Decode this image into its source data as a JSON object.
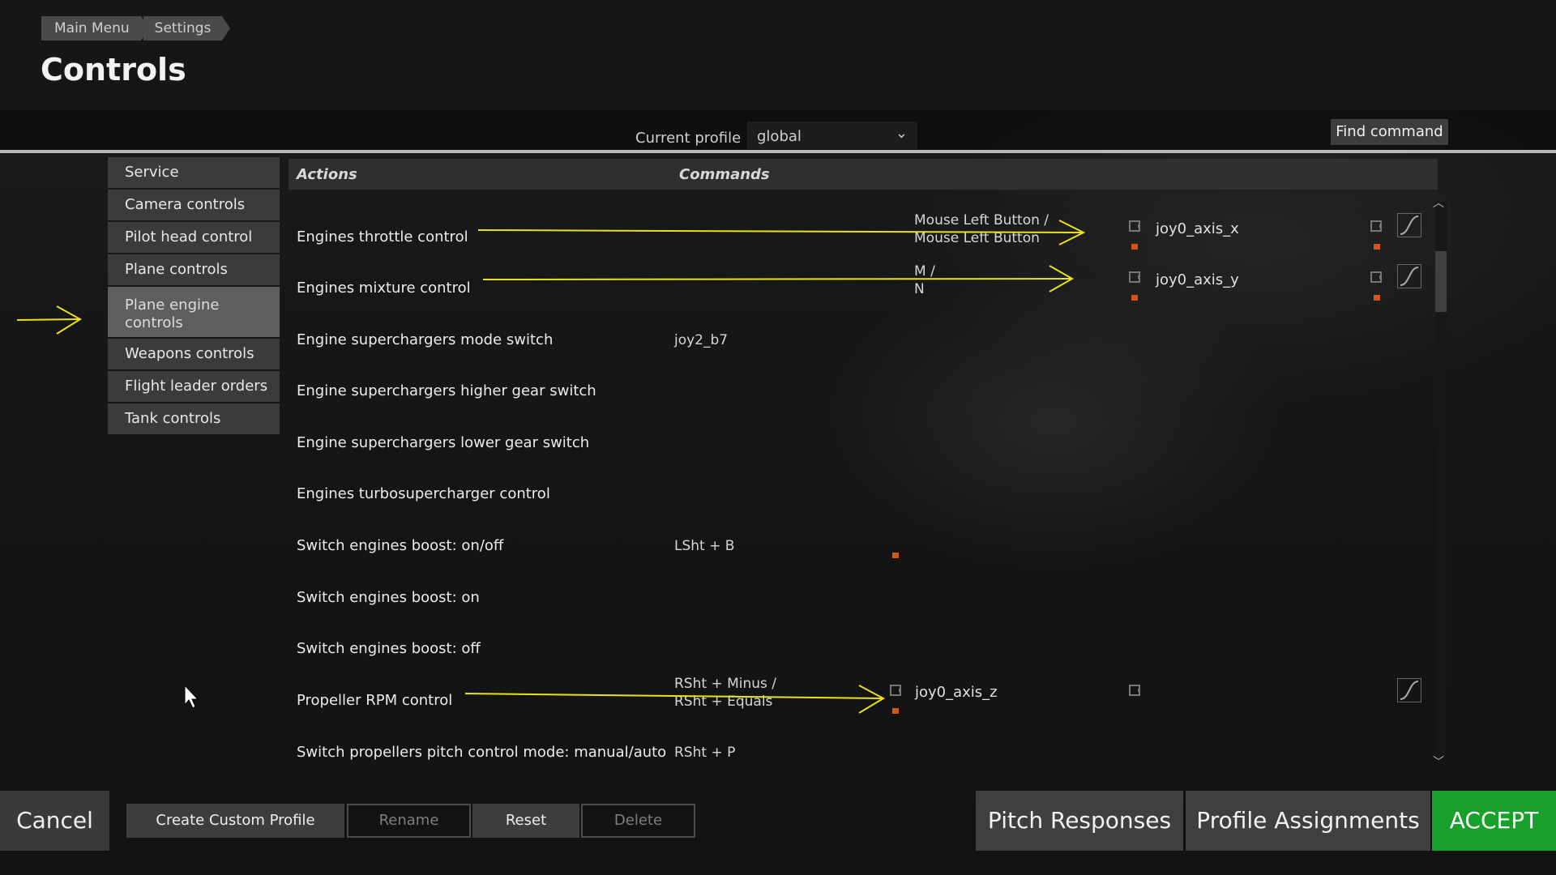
{
  "header": {
    "breadcrumb": [
      "Main Menu",
      "Settings"
    ],
    "title": "Controls"
  },
  "profile": {
    "label": "Current profile",
    "value": "global",
    "find_command_label": "Find command"
  },
  "sidebar": {
    "items": [
      {
        "label": "Service"
      },
      {
        "label": "Camera controls"
      },
      {
        "label": "Pilot head control"
      },
      {
        "label": "Plane controls"
      },
      {
        "label": "Plane engine controls"
      },
      {
        "label": "Weapons controls"
      },
      {
        "label": "Flight leader orders"
      },
      {
        "label": "Tank controls"
      }
    ]
  },
  "table": {
    "col_actions": "Actions",
    "col_commands": "Commands",
    "rows": [
      {
        "action": "Engines throttle control",
        "cmd2": "Mouse Left Button /\nMouse Left Button",
        "axis": "joy0_axis_x"
      },
      {
        "action": "Engines mixture control",
        "cmd2": "M /\nN",
        "axis": "joy0_axis_y"
      },
      {
        "action": "Engine superchargers mode switch",
        "cmd1": "joy2_b7"
      },
      {
        "action": "Engine superchargers higher gear switch"
      },
      {
        "action": "Engine superchargers lower gear switch"
      },
      {
        "action": "Engines turbosupercharger control"
      },
      {
        "action": "Switch engines boost: on/off",
        "cmd1": "LSht + B"
      },
      {
        "action": "Switch engines boost: on"
      },
      {
        "action": "Switch engines boost: off"
      },
      {
        "action": "Propeller RPM control",
        "cmd1": "RSht + Minus /\nRSht + Equals",
        "axis": "joy0_axis_z"
      },
      {
        "action": "Switch propellers pitch control mode: manual/auto",
        "cmd1": "RSht + P"
      }
    ]
  },
  "footer": {
    "cancel": "Cancel",
    "create_profile": "Create Custom Profile",
    "rename": "Rename",
    "reset": "Reset",
    "delete": "Delete",
    "pitch_responses": "Pitch Responses",
    "profile_assignments": "Profile Assignments",
    "accept": "ACCEPT"
  },
  "colors": {
    "accept": "#18a02b",
    "annotation_arrows": "#e8e21a",
    "binding_dot": "#d4541a"
  }
}
